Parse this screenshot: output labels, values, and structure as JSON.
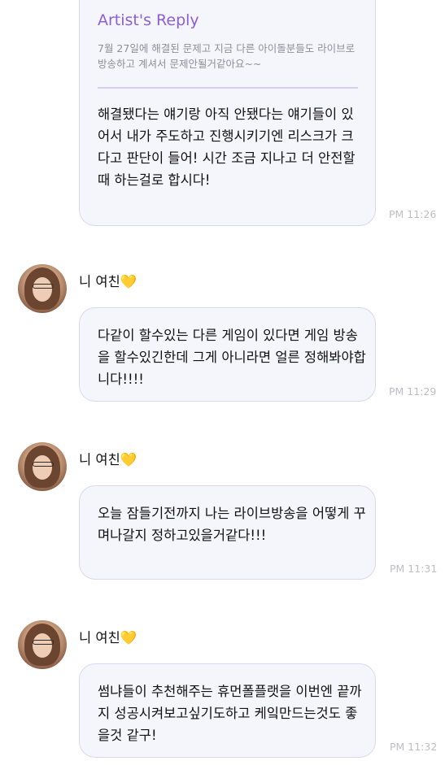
{
  "artist_reply": {
    "title": "Artist's Reply",
    "quoted": "7월 27일에 해결된 문제고 지금 다른 아이돌분들도 라이브로 방송하고 계셔서 문제안될거같아요~~",
    "body": "해결됐다는 얘기랑 아직 안됐다는 얘기들이 있어서 내가 주도하고 진행시키기엔 리스크가 크다고 판단이 들어! 시간 조금 지나고 더 안전할때 하는걸로 합시다!",
    "time": "PM 11:26"
  },
  "messages": [
    {
      "sender": "니 여친",
      "heart": "💛",
      "text": "다같이 할수있는 다른 게임이 있다면 게임 방송을 할수있긴한데 그게 아니라면 얼른 정해봐야합니다!!!!",
      "time": "PM 11:29"
    },
    {
      "sender": "니 여친",
      "heart": "💛",
      "text": "오늘 잠들기전까지 나는 라이브방송을 어떻게 꾸며나갈지 정하고있을거같다!!!",
      "time": "PM 11:31"
    },
    {
      "sender": "니 여친",
      "heart": "💛",
      "text": "썸냐들이 추천해주는 휴먼폴플랫을 이번엔 끝까지 성공시켜보고싶기도하고 케잌만드는것도 좋을것 같구!",
      "time": "PM 11:32"
    }
  ],
  "colors": {
    "bubble_bg": "#f5f5fc",
    "bubble_border": "#ddd6f2",
    "reply_title": "#8b5fd6",
    "time_text": "#bdbdc3",
    "heart": "#f2c200"
  }
}
